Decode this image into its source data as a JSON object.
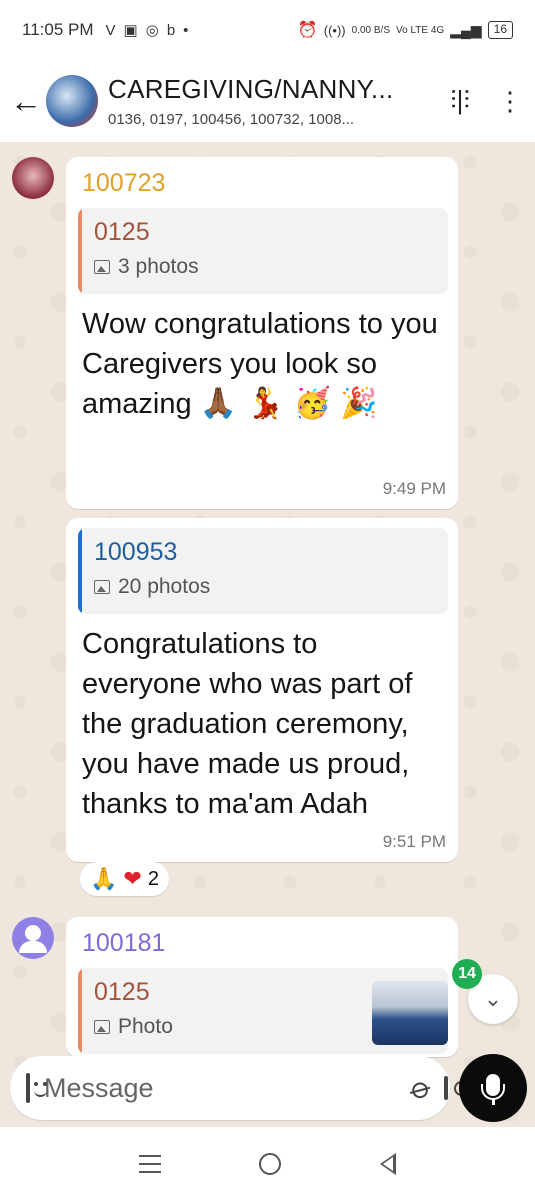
{
  "status_bar": {
    "time": "11:05 PM",
    "notification_icons": [
      "V",
      "▣",
      "◎",
      "b",
      "•"
    ],
    "net_speed": "0.00 B/S",
    "network": "Vo LTE 4G",
    "battery": "16"
  },
  "header": {
    "title": "CAREGIVING/NANNY...",
    "subtitle": "0136, 0197, 100456, 100732, 1008..."
  },
  "messages": [
    {
      "sender": "100723",
      "sender_color": "#e0a12a",
      "quote": {
        "name": "0125",
        "meta": "3 photos",
        "accent": "#e88a66"
      },
      "text": "Wow congratulations to you Caregivers you look so amazing",
      "emojis": "🙏🏾 💃 🥳 🎉",
      "time": "9:49 PM"
    },
    {
      "quote": {
        "name": "100953",
        "meta": "20 photos",
        "accent": "#1f6fd0"
      },
      "text": "Congratulations to everyone who was part of the graduation ceremony, you have made us proud, thanks to ma'am Adah",
      "time": "9:51 PM",
      "reaction": {
        "emojis": [
          "🙏",
          "❤"
        ],
        "count": "2"
      }
    },
    {
      "sender": "100181",
      "sender_color": "#7b6cd8",
      "quote": {
        "name": "0125",
        "meta": "Photo",
        "accent": "#e88a66"
      }
    }
  ],
  "unread_badge": "14",
  "composer": {
    "placeholder": "Message"
  }
}
